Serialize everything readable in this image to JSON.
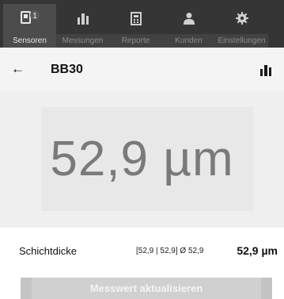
{
  "tabs": [
    {
      "label": "Sensoren",
      "icon": "sensor-icon",
      "badge": "1",
      "active": true
    },
    {
      "label": "Messungen",
      "icon": "bar-chart-icon",
      "active": false
    },
    {
      "label": "Reporte",
      "icon": "report-icon",
      "active": false
    },
    {
      "label": "Kunden",
      "icon": "customer-icon",
      "active": false
    },
    {
      "label": "Einstellungen",
      "icon": "gear-icon",
      "active": false
    }
  ],
  "header": {
    "back_glyph": "←",
    "title": "BB30",
    "chart_icon": "bar-chart-icon"
  },
  "measurement": {
    "big_value": "52,9 µm"
  },
  "result_row": {
    "name": "Schichtdicke",
    "stats": "[52,9 | 52,9] Ø 52,9",
    "value": "52,9 µm"
  },
  "action": {
    "label": "Messwert aktualisieren"
  },
  "colors": {
    "tabbar": "#353535",
    "active_tab": "#4c4c4c",
    "panel": "#efefef",
    "value_text": "#7a7a7a"
  }
}
